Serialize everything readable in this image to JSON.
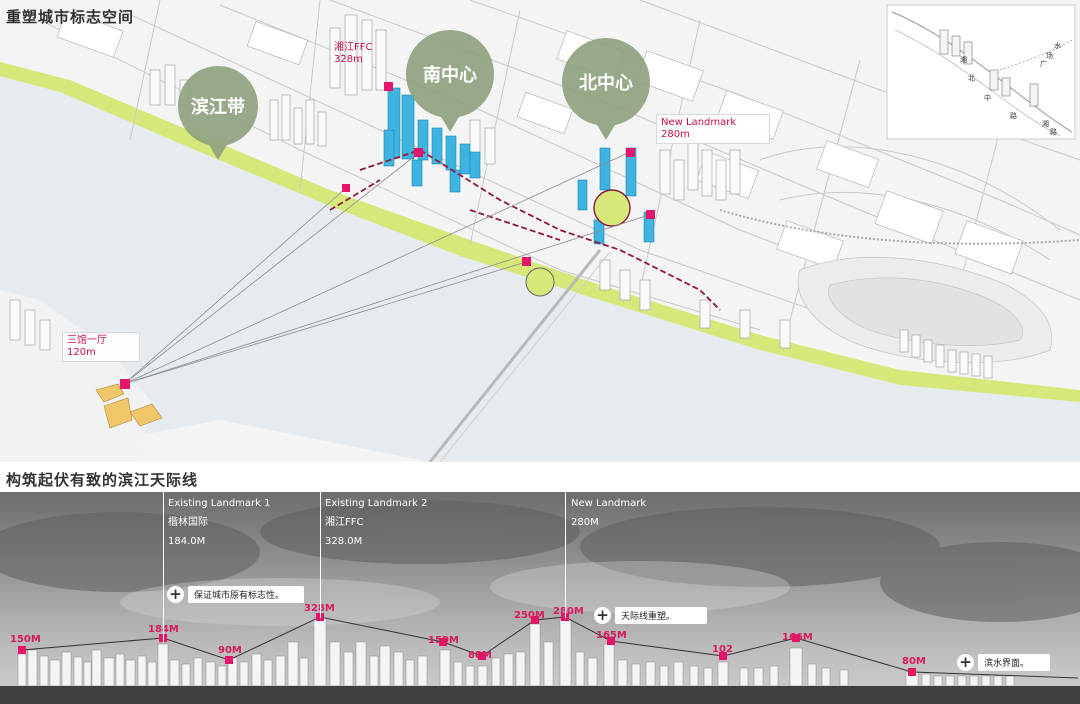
{
  "sections": {
    "map_title": "重塑城市标志空间",
    "skyline_title": "构筑起伏有致的滨江天际线"
  },
  "map": {
    "bubbles": [
      {
        "label": "滨江带"
      },
      {
        "label": "南中心"
      },
      {
        "label": "北中心"
      }
    ],
    "tags": [
      {
        "name": "湘江FFC",
        "height": "328m"
      },
      {
        "name": "New Landmark",
        "height": "280m"
      },
      {
        "name": "三馆一厅",
        "height": "120m"
      }
    ],
    "inset_roads": [
      "湘",
      "北",
      "中",
      "路",
      "广",
      "场",
      "水",
      "湘",
      "路"
    ],
    "colors": {
      "greenbelt": "#d6e87a",
      "tower": "#3fb4e0",
      "landmark": "#e4156a",
      "water": "#e7ecf0",
      "bubble": "#8ea17e"
    }
  },
  "skyline": {
    "landmarks": [
      {
        "title": "Existing Landmark  1",
        "name": "楷林国际",
        "height": "184.0M"
      },
      {
        "title": "Existing Landmark  2",
        "name": "湘江FFC",
        "height": "328.0M"
      },
      {
        "title": "New Landmark",
        "name": "",
        "height": "280M"
      }
    ],
    "callouts": [
      {
        "icon": "plus-icon",
        "text": "保证城市原有标志性。"
      },
      {
        "icon": "plus-icon",
        "text": "天际线重塑。"
      },
      {
        "icon": "plus-icon",
        "text": "滨水界面。"
      }
    ],
    "peaks": [
      {
        "label": "150M"
      },
      {
        "label": "184M"
      },
      {
        "label": "90M"
      },
      {
        "label": "328M"
      },
      {
        "label": "150M"
      },
      {
        "label": "80M"
      },
      {
        "label": "250M"
      },
      {
        "label": "280M"
      },
      {
        "label": "165M"
      },
      {
        "label": "102"
      },
      {
        "label": "166M"
      },
      {
        "label": "80M"
      }
    ]
  }
}
